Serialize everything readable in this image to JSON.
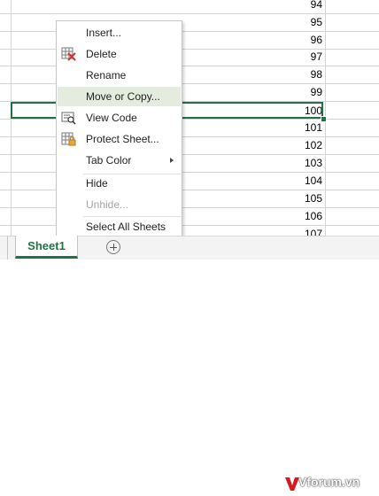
{
  "grid": {
    "row_values": [
      "94",
      "95",
      "96",
      "97",
      "98",
      "99",
      "100",
      "101",
      "102",
      "103",
      "104",
      "105",
      "106",
      "107"
    ],
    "selected_value": "100"
  },
  "context_menu": {
    "items": [
      {
        "label": "Insert...",
        "icon": "",
        "enabled": true
      },
      {
        "label": "Delete",
        "icon": "delete-sheet-icon",
        "enabled": true
      },
      {
        "label": "Rename",
        "icon": "",
        "enabled": true
      },
      {
        "label": "Move or Copy...",
        "icon": "",
        "enabled": true,
        "highlighted": true
      },
      {
        "label": "View Code",
        "icon": "view-code-icon",
        "enabled": true
      },
      {
        "label": "Protect Sheet...",
        "icon": "protect-sheet-icon",
        "enabled": true
      },
      {
        "label": "Tab Color",
        "icon": "",
        "enabled": true,
        "submenu": true
      },
      {
        "label": "Hide",
        "icon": "",
        "enabled": true
      },
      {
        "label": "Unhide...",
        "icon": "",
        "enabled": false
      },
      {
        "label": "Select All Sheets",
        "icon": "",
        "enabled": true
      }
    ]
  },
  "sheet_tabs": {
    "active": "Sheet1",
    "add_icon": "plus-circle-icon"
  },
  "watermark": {
    "text": "Vforum.vn"
  },
  "colors": {
    "accent": "#217346",
    "hover": "#e3ecdf",
    "gridline": "#d4d4d4",
    "disabled": "#a6a6a6"
  }
}
